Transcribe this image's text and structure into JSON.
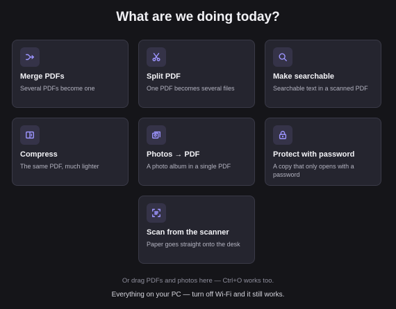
{
  "header": {
    "title": "What are we doing today?"
  },
  "cards": [
    {
      "title": "Merge PDFs",
      "desc": "Several PDFs become one",
      "icon": "merge-icon"
    },
    {
      "title": "Split PDF",
      "desc": "One PDF becomes several files",
      "icon": "scissors-icon"
    },
    {
      "title": "Make searchable",
      "desc": "Searchable text in a scanned PDF",
      "icon": "search-icon"
    },
    {
      "title": "Compress",
      "desc": "The same PDF, much lighter",
      "icon": "compress-icon"
    },
    {
      "title": "Photos → PDF",
      "desc": "A photo album in a single PDF",
      "icon": "photos-icon"
    },
    {
      "title": "Protect with password",
      "desc": "A copy that only opens with a password",
      "icon": "lock-icon"
    },
    {
      "title": "Scan from the scanner",
      "desc": "Paper goes straight onto the desk",
      "icon": "scanner-icon"
    }
  ],
  "footer": {
    "hint": "Or drag PDFs and photos here — Ctrl+O works too.",
    "privacy": "Everything on your PC — turn off Wi-Fi and it still works."
  },
  "colors": {
    "background": "#151519",
    "card": "#25252f",
    "card_border": "#3a3a47",
    "icon_tile": "#353348",
    "accent": "#9d95ff"
  }
}
